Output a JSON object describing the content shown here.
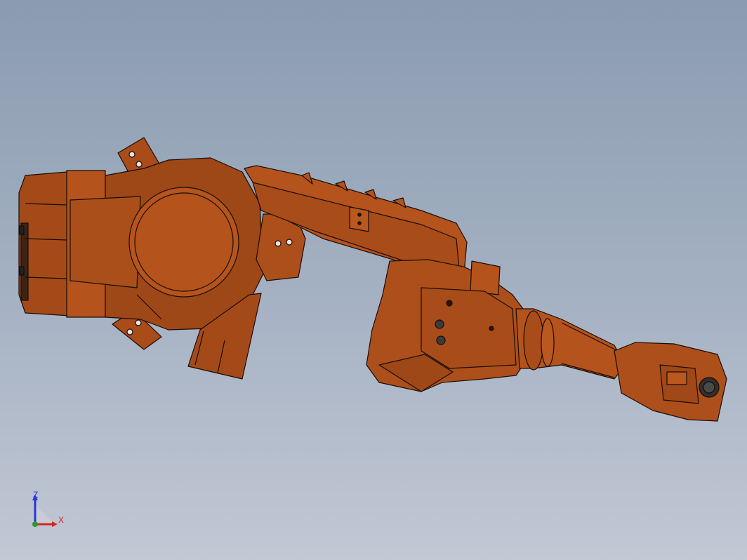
{
  "viewport": {
    "background_top": "#8b9bb0",
    "background_bottom": "#c2c8d4"
  },
  "model": {
    "color": "#b4531c",
    "shadow_color": "#4c2410",
    "edge_color": "#1a0c05"
  },
  "triad": {
    "z_label": "Z",
    "x_label": "X",
    "z_color": "#2b36d9",
    "x_color": "#d62424",
    "y_color": "#2a9a2a"
  }
}
